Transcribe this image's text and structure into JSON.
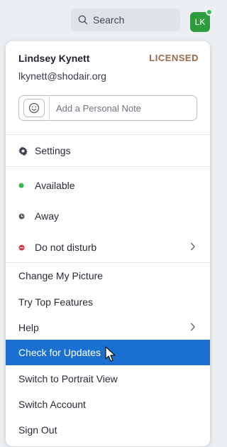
{
  "search": {
    "label": "Search"
  },
  "avatar": {
    "initials": "LK",
    "status_color": "#35c15a"
  },
  "profile": {
    "name": "Lindsey Kynett",
    "license": "LICENSED",
    "email": "lkynett@shodair.org",
    "note_placeholder": "Add a Personal Note"
  },
  "menu": {
    "settings": "Settings",
    "status": [
      {
        "label": "Available",
        "color": "#2dbd4e",
        "icon": "green-dot-icon"
      },
      {
        "label": "Away",
        "color": "#5a5f66",
        "icon": "clock-dot-icon"
      },
      {
        "label": "Do not disturb",
        "color": "#e0313c",
        "icon": "red-dot-icon",
        "has_submenu": true
      }
    ],
    "actions": [
      {
        "label": "Change My Picture"
      },
      {
        "label": "Try Top Features"
      },
      {
        "label": "Help",
        "has_submenu": true
      },
      {
        "label": "Check for Updates",
        "highlighted": true
      },
      {
        "label": "Switch to Portrait View"
      },
      {
        "label": "Switch Account"
      },
      {
        "label": "Sign Out"
      }
    ]
  },
  "colors": {
    "accent": "#1b6fd1",
    "license": "#9b6a4a"
  }
}
